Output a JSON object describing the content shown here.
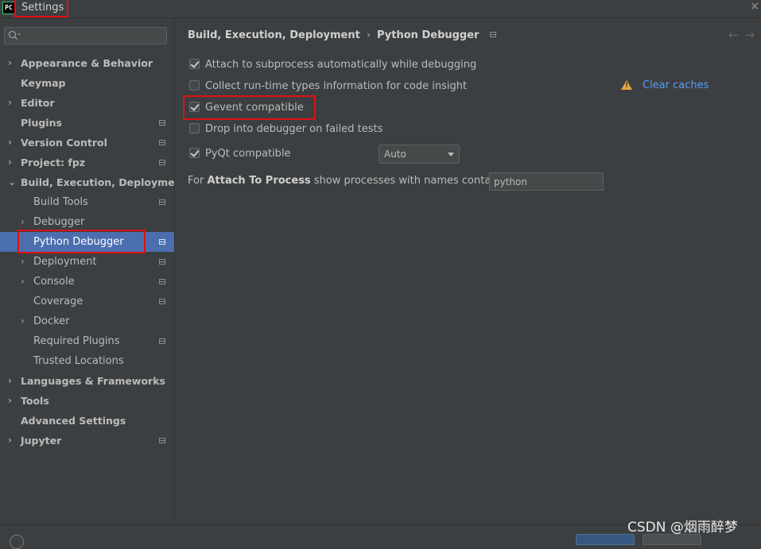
{
  "window": {
    "title": "Settings",
    "app_icon_text": "PC",
    "close_glyph": "×"
  },
  "search": {
    "placeholder": "",
    "value": ""
  },
  "sidebar": {
    "items": [
      {
        "label": "Appearance & Behavior",
        "bold": true,
        "arrow": "›",
        "level": 0
      },
      {
        "label": "Keymap",
        "bold": true,
        "arrow": "",
        "level": 0
      },
      {
        "label": "Editor",
        "bold": true,
        "arrow": "›",
        "level": 0
      },
      {
        "label": "Plugins",
        "bold": true,
        "arrow": "",
        "level": 0,
        "badge": true
      },
      {
        "label": "Version Control",
        "bold": true,
        "arrow": "›",
        "level": 0,
        "badge": true
      },
      {
        "label": "Project: fpz",
        "bold": true,
        "arrow": "›",
        "level": 0,
        "badge": true
      },
      {
        "label": "Build, Execution, Deployment",
        "bold": true,
        "arrow": "⌄",
        "level": 0
      },
      {
        "label": "Build Tools",
        "bold": false,
        "arrow": "",
        "level": 1,
        "badge": true
      },
      {
        "label": "Debugger",
        "bold": false,
        "arrow": "›",
        "level": 1
      },
      {
        "label": "Python Debugger",
        "bold": false,
        "arrow": "",
        "level": 1,
        "badge": true,
        "selected": true
      },
      {
        "label": "Deployment",
        "bold": false,
        "arrow": "›",
        "level": 1,
        "badge": true
      },
      {
        "label": "Console",
        "bold": false,
        "arrow": "›",
        "level": 1,
        "badge": true
      },
      {
        "label": "Coverage",
        "bold": false,
        "arrow": "",
        "level": 1,
        "badge": true
      },
      {
        "label": "Docker",
        "bold": false,
        "arrow": "›",
        "level": 1
      },
      {
        "label": "Required Plugins",
        "bold": false,
        "arrow": "",
        "level": 1,
        "badge": true
      },
      {
        "label": "Trusted Locations",
        "bold": false,
        "arrow": "",
        "level": 1
      },
      {
        "label": "Languages & Frameworks",
        "bold": true,
        "arrow": "›",
        "level": 0
      },
      {
        "label": "Tools",
        "bold": true,
        "arrow": "›",
        "level": 0
      },
      {
        "label": "Advanced Settings",
        "bold": true,
        "arrow": "",
        "level": 0
      },
      {
        "label": "Jupyter",
        "bold": true,
        "arrow": "›",
        "level": 0,
        "badge": true
      }
    ]
  },
  "breadcrumb": {
    "parent": "Build, Execution, Deployment",
    "separator": "›",
    "current": "Python Debugger"
  },
  "nav": {
    "back": "←",
    "forward": "→"
  },
  "options": {
    "attach_subprocess": {
      "label": "Attach to subprocess automatically while debugging",
      "checked": true
    },
    "collect_types": {
      "label": "Collect run-time types information for code insight",
      "checked": false
    },
    "clear_caches": "Clear caches",
    "warning_glyph": "!",
    "gevent": {
      "label": "Gevent compatible",
      "checked": true
    },
    "drop_debugger": {
      "label": "Drop into debugger on failed tests",
      "checked": false
    },
    "pyqt": {
      "label": "PyQt compatible",
      "checked": true
    },
    "pyqt_mode": "Auto"
  },
  "attach_process": {
    "prefix": "For",
    "bold": "Attach To Process",
    "suffix": "show processes with names containing:",
    "value": "python"
  },
  "watermark": "CSDN @烟雨醉梦",
  "colors": {
    "background": "#3c3f41",
    "selection": "#4b6eaf",
    "link": "#589df6",
    "warning": "#e7a33e",
    "highlight_box": "#e01010"
  }
}
